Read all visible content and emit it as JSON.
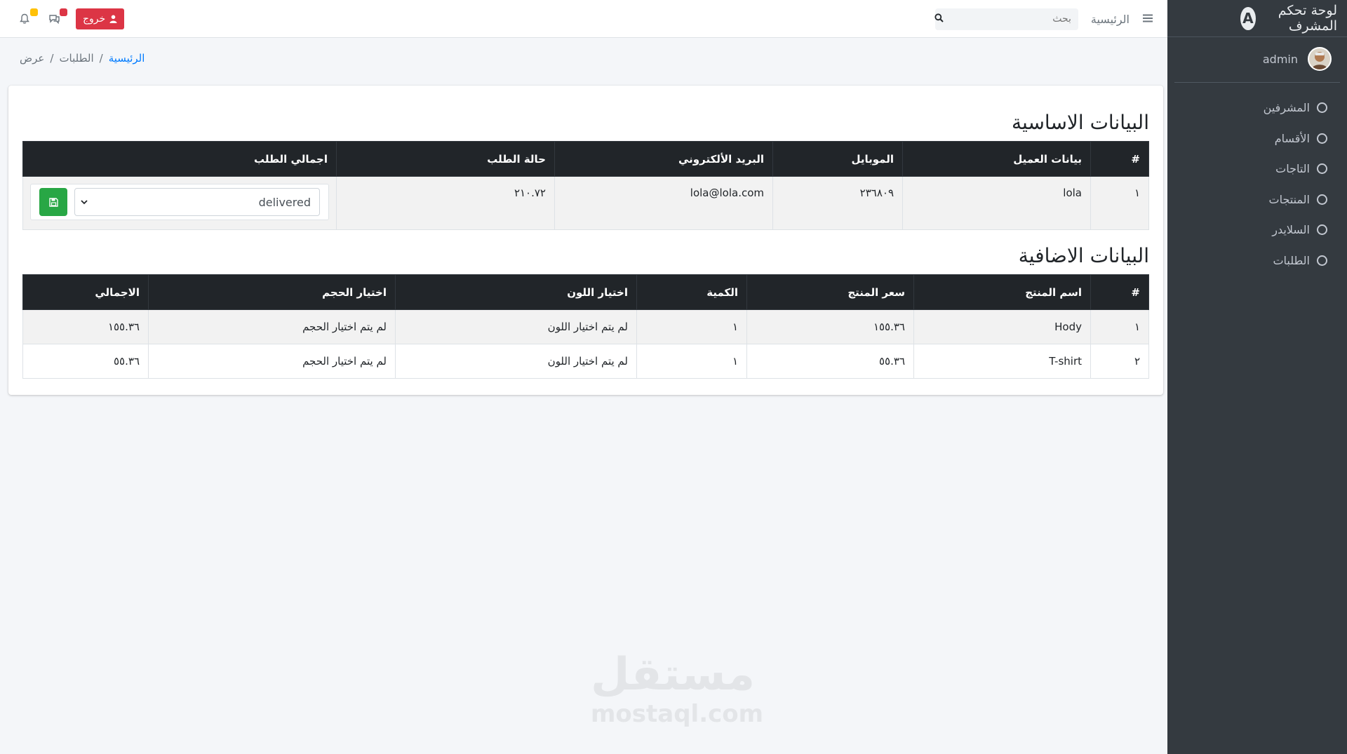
{
  "sidebar": {
    "brand_title": "لوحة تحكم المشرف",
    "brand_logo_letter": "A",
    "user_name": "admin",
    "items": [
      {
        "label": "المشرفين"
      },
      {
        "label": "الأقسام"
      },
      {
        "label": "التاجات"
      },
      {
        "label": "المنتجات"
      },
      {
        "label": "السلايدر"
      },
      {
        "label": "الطلبات"
      }
    ]
  },
  "navbar": {
    "home_label": "الرئيسية",
    "search_placeholder": "بحث",
    "logout_label": "خروج",
    "messages_badge": "",
    "notifications_badge": ""
  },
  "breadcrumb": {
    "home": "الرئيسية",
    "orders": "الطلبات",
    "current": "عرض",
    "separator": "/"
  },
  "basic": {
    "title": "البيانات الاساسية",
    "headers": [
      "#",
      "بيانات العميل",
      "الموبايل",
      "البريد الألكتروني",
      "حالة الطلب",
      "اجمالي الطلب"
    ],
    "row": {
      "index": "١",
      "customer": "lola",
      "mobile": "٢٣٦٨٠٩",
      "email": "lola@lola.com",
      "total": "٢١٠.٧٢",
      "status_value": "delivered"
    }
  },
  "extra": {
    "title": "البيانات الاضافية",
    "headers": [
      "#",
      "اسم المنتج",
      "سعر المنتج",
      "الكمية",
      "اختيار اللون",
      "اختيار الحجم",
      "الاجمالي"
    ],
    "rows": [
      {
        "index": "١",
        "name": "Hody",
        "price": "١٥٥.٣٦",
        "qty": "١",
        "color": "لم يتم اختيار اللون",
        "size": "لم يتم اختيار الحجم",
        "total": "١٥٥.٣٦"
      },
      {
        "index": "٢",
        "name": "T-shirt",
        "price": "٥٥.٣٦",
        "qty": "١",
        "color": "لم يتم اختيار اللون",
        "size": "لم يتم اختيار الحجم",
        "total": "٥٥.٣٦"
      }
    ]
  },
  "watermark": {
    "arabic": "مستقل",
    "latin": "mostaql.com"
  },
  "colors": {
    "sidebar_bg": "#343a40",
    "logout_red": "#dc3545",
    "save_green": "#28a745",
    "link_blue": "#007bff",
    "table_head": "#212529"
  }
}
